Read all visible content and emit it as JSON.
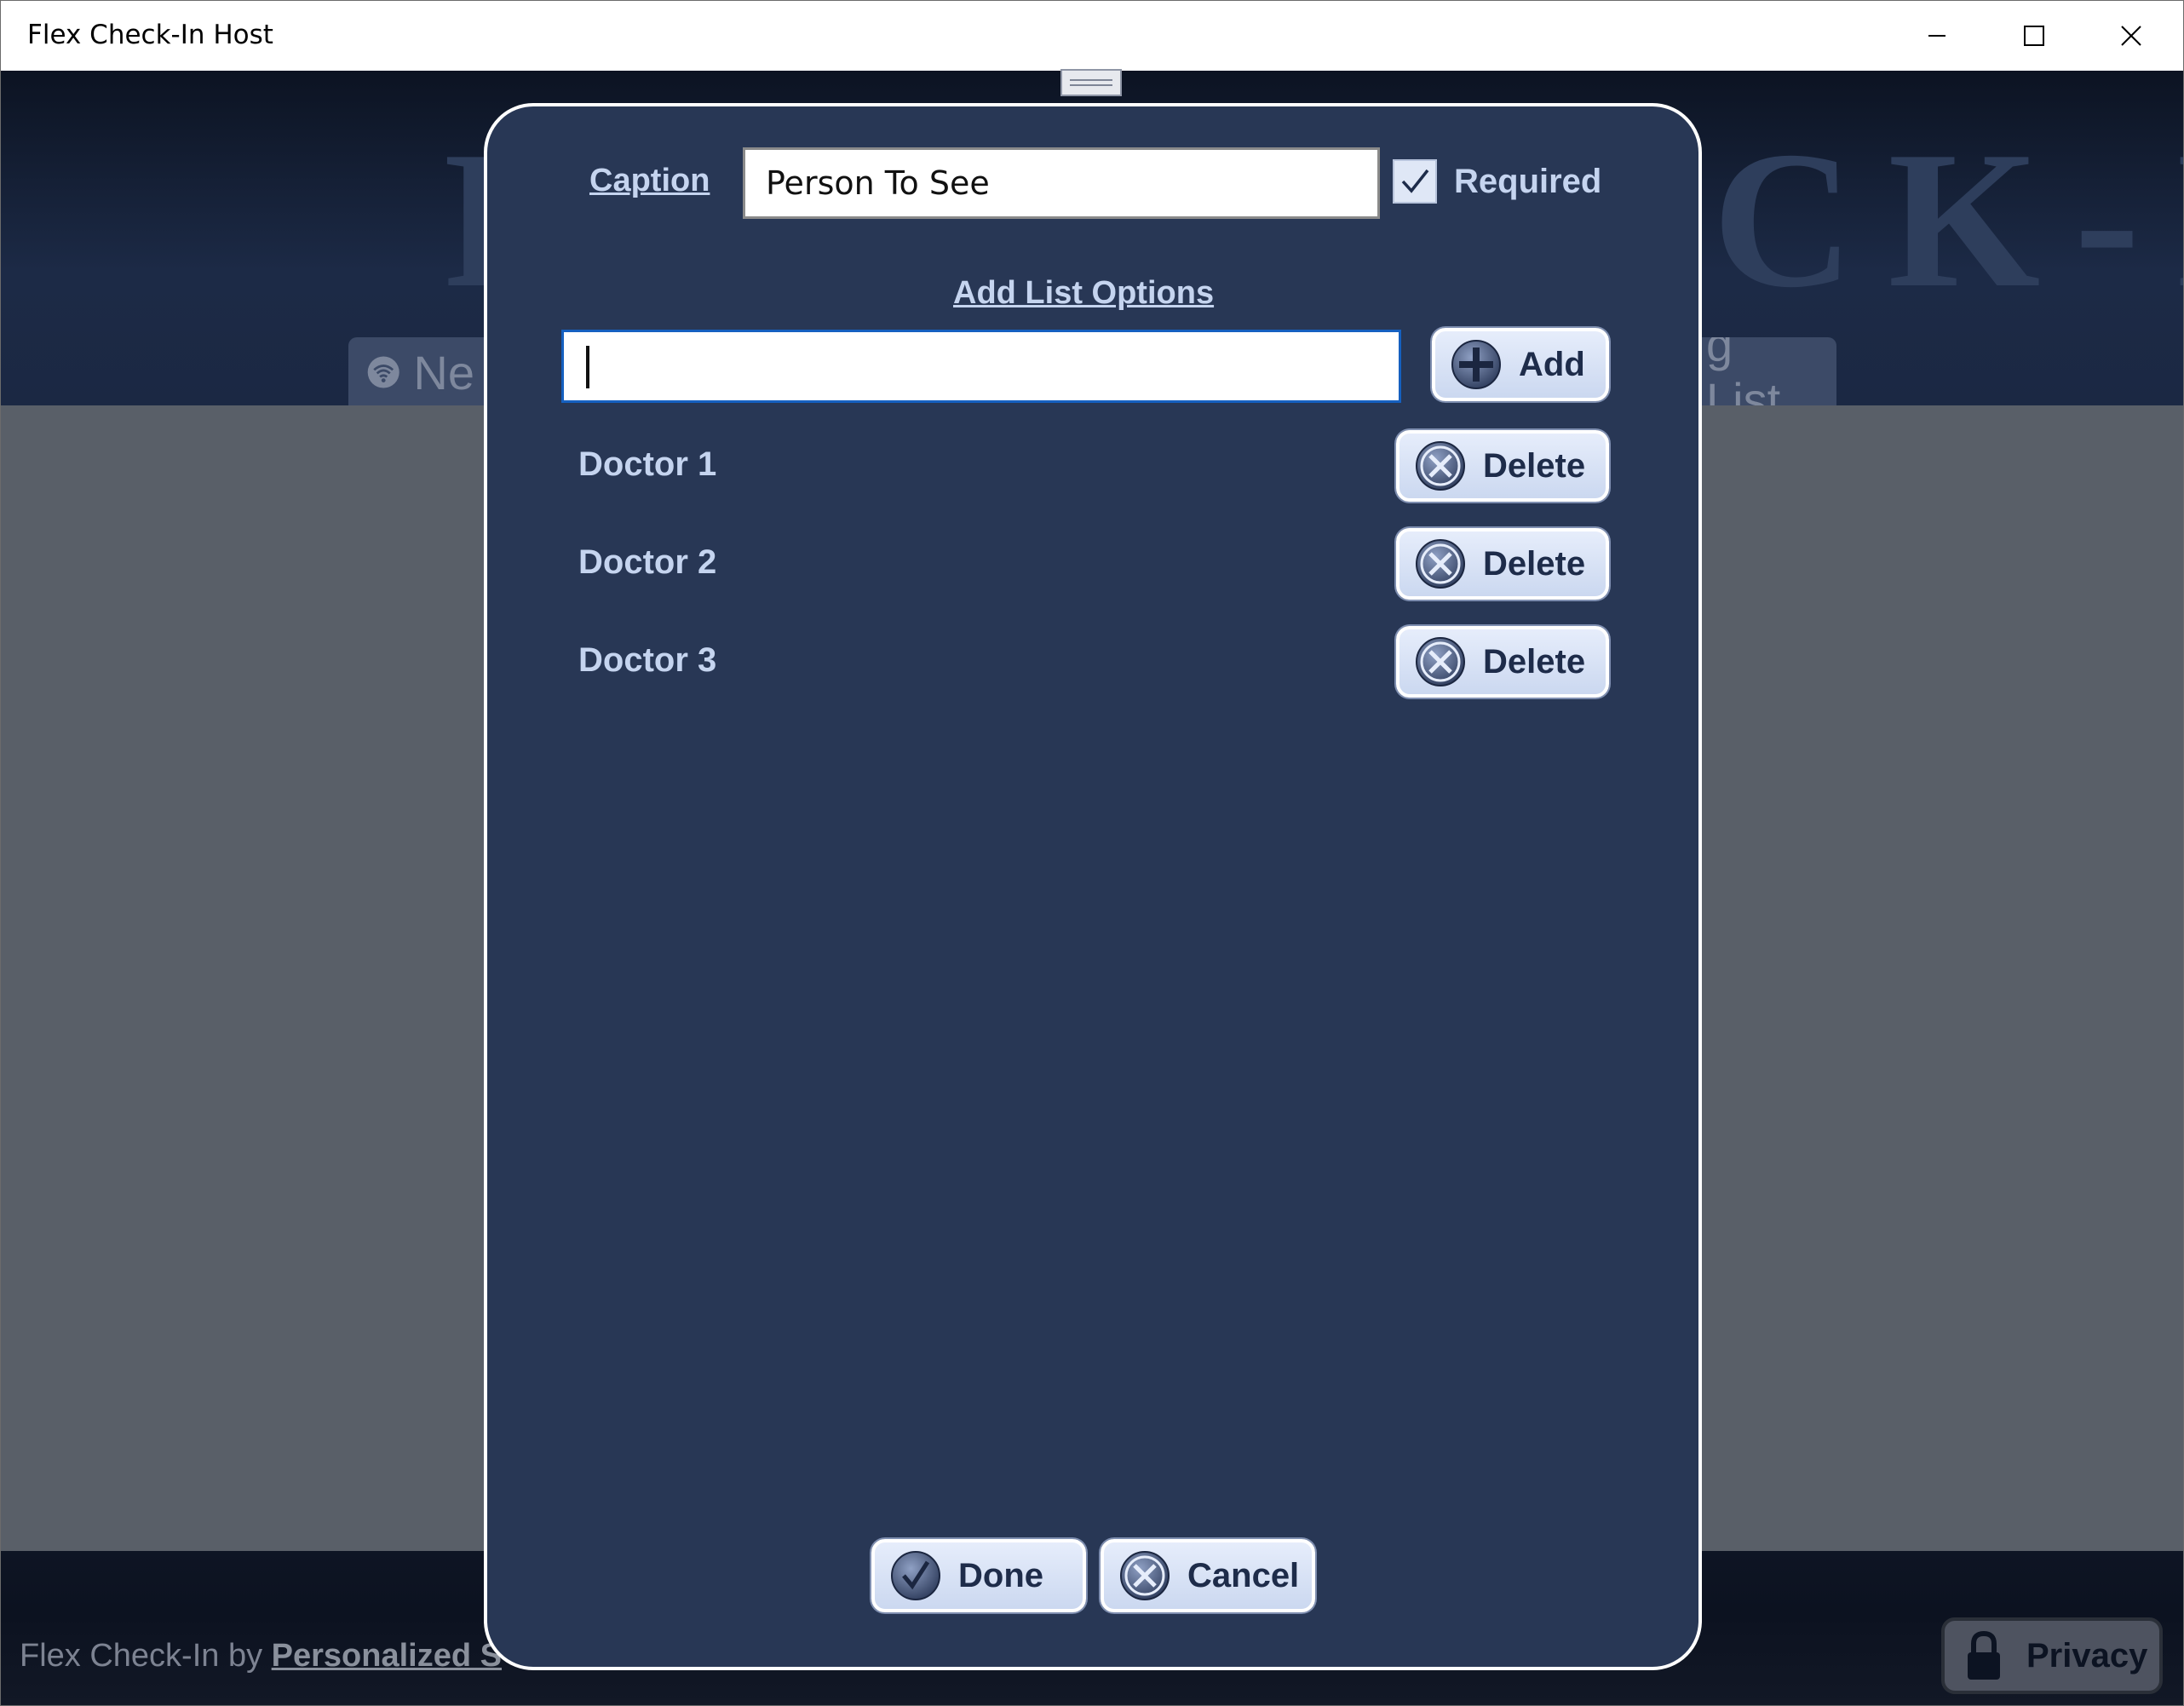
{
  "window": {
    "title": "Flex Check-In Host"
  },
  "background": {
    "logo_text": "FLEX CHECK-IN HOST",
    "nav_tab_left_label": "Ne",
    "nav_tab_right_label": "g List",
    "footer_prefix": "Flex Check-In by",
    "footer_link": "Personalized S",
    "privacy_label": "Privacy"
  },
  "dialog": {
    "caption_label": "Caption",
    "caption_value": "Person To See",
    "required_label": "Required",
    "required_checked": true,
    "add_options_title": "Add List Options",
    "option_input_value": "",
    "add_button_label": "Add",
    "options": [
      {
        "label": "Doctor 1",
        "delete_label": "Delete"
      },
      {
        "label": "Doctor 2",
        "delete_label": "Delete"
      },
      {
        "label": "Doctor 3",
        "delete_label": "Delete"
      }
    ],
    "done_label": "Done",
    "cancel_label": "Cancel"
  },
  "colors": {
    "dialog_bg": "#283755",
    "label_text": "#c5d4ef",
    "button_bg": "#cbd8f0",
    "app_body": "#595f68"
  },
  "icons": {
    "add": "plus-circle-icon",
    "delete": "x-circle-icon",
    "done": "check-circle-icon",
    "cancel": "x-circle-icon",
    "privacy": "lock-icon",
    "network": "wifi-icon"
  }
}
